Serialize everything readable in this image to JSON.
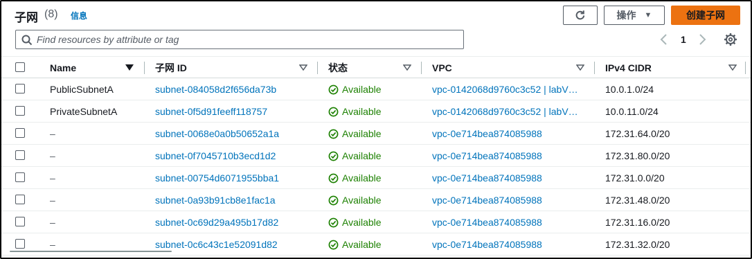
{
  "header": {
    "title": "子网",
    "count": "(8)",
    "info_label": "信息"
  },
  "toolbar": {
    "actions_label": "操作",
    "create_label": "创建子网"
  },
  "search": {
    "placeholder": "Find resources by attribute or tag",
    "value": ""
  },
  "pagination": {
    "current_page": "1"
  },
  "columns": {
    "name": "Name",
    "subnet_id": "子网 ID",
    "state": "状态",
    "vpc": "VPC",
    "cidr": "IPv4 CIDR"
  },
  "rows": [
    {
      "name": "PublicSubnetA",
      "subnet_id": "subnet-084058d2f656da73b",
      "state": "Available",
      "vpc": "vpc-0142068d9760c3c52 | labV…",
      "cidr": "10.0.1.0/24"
    },
    {
      "name": "PrivateSubnetA",
      "subnet_id": "subnet-0f5d91feeff118757",
      "state": "Available",
      "vpc": "vpc-0142068d9760c3c52 | labV…",
      "cidr": "10.0.11.0/24"
    },
    {
      "name": "–",
      "subnet_id": "subnet-0068e0a0b50652a1a",
      "state": "Available",
      "vpc": "vpc-0e714bea874085988",
      "cidr": "172.31.64.0/20"
    },
    {
      "name": "–",
      "subnet_id": "subnet-0f7045710b3ecd1d2",
      "state": "Available",
      "vpc": "vpc-0e714bea874085988",
      "cidr": "172.31.80.0/20"
    },
    {
      "name": "–",
      "subnet_id": "subnet-00754d6071955bba1",
      "state": "Available",
      "vpc": "vpc-0e714bea874085988",
      "cidr": "172.31.0.0/20"
    },
    {
      "name": "–",
      "subnet_id": "subnet-0a93b91cb8e1fac1a",
      "state": "Available",
      "vpc": "vpc-0e714bea874085988",
      "cidr": "172.31.48.0/20"
    },
    {
      "name": "–",
      "subnet_id": "subnet-0c69d29a495b17d82",
      "state": "Available",
      "vpc": "vpc-0e714bea874085988",
      "cidr": "172.31.16.0/20"
    },
    {
      "name": "–",
      "subnet_id": "subnet-0c6c43c1e52091d82",
      "state": "Available",
      "vpc": "vpc-0e714bea874085988",
      "cidr": "172.31.32.0/20"
    }
  ],
  "colors": {
    "link": "#0073bb",
    "status_available": "#1d8102",
    "primary_button": "#ec7211"
  },
  "icons": {
    "refresh": "refresh-icon",
    "search": "search-icon",
    "settings": "gear-icon",
    "status": "check-circle-icon"
  }
}
